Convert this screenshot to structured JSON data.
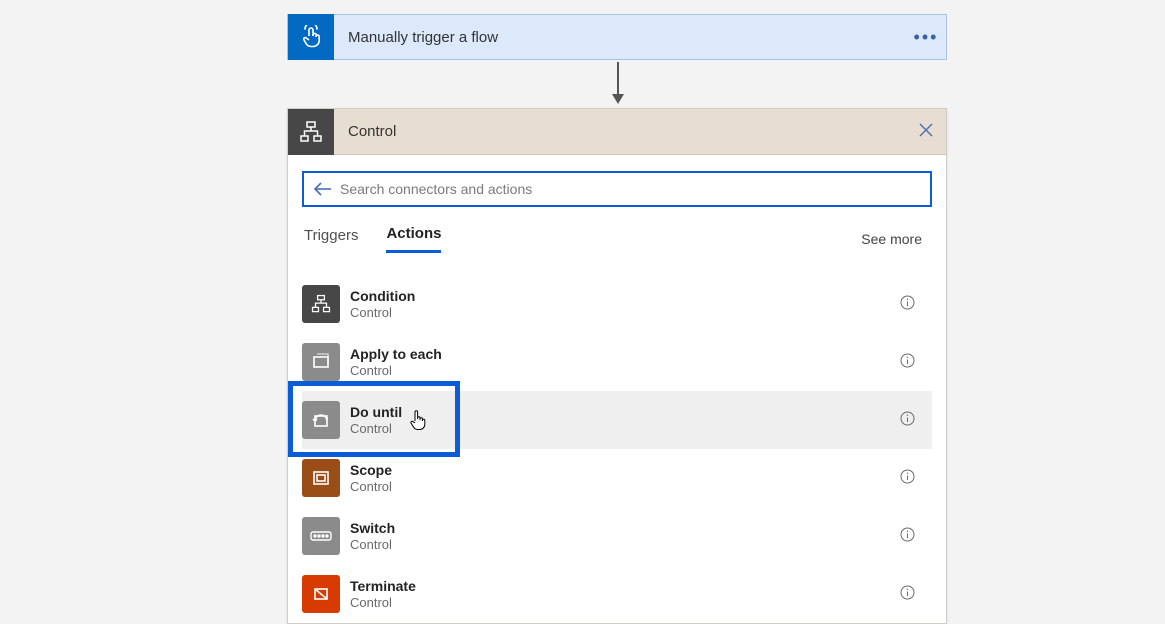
{
  "trigger": {
    "label": "Manually trigger a flow",
    "icon": "touch-icon"
  },
  "control": {
    "title": "Control",
    "icon": "control-icon"
  },
  "search": {
    "placeholder": "Search connectors and actions"
  },
  "tabs": {
    "triggers": "Triggers",
    "actions": "Actions",
    "see_more": "See more"
  },
  "actions": [
    {
      "title": "Condition",
      "sub": "Control",
      "icon_style": "dark",
      "icon": "condition"
    },
    {
      "title": "Apply to each",
      "sub": "Control",
      "icon_style": "grey",
      "icon": "apply-each"
    },
    {
      "title": "Do until",
      "sub": "Control",
      "icon_style": "grey",
      "icon": "do-until",
      "highlighted": true,
      "hovered": true
    },
    {
      "title": "Scope",
      "sub": "Control",
      "icon_style": "brown",
      "icon": "scope"
    },
    {
      "title": "Switch",
      "sub": "Control",
      "icon_style": "grey",
      "icon": "switch"
    },
    {
      "title": "Terminate",
      "sub": "Control",
      "icon_style": "red",
      "icon": "terminate"
    }
  ]
}
